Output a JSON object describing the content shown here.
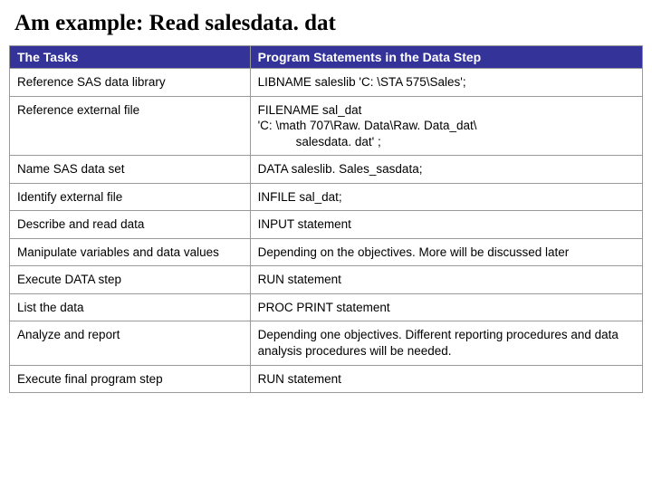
{
  "title": "Am example: Read salesdata. dat",
  "table": {
    "headers": {
      "tasks": "The Tasks",
      "statements": "Program Statements in the Data Step"
    },
    "rows": [
      {
        "task": "Reference SAS data library",
        "stmt": "LIBNAME saleslib 'C: \\STA 575\\Sales';"
      },
      {
        "task": "Reference external file",
        "stmt_line1": "FILENAME sal_dat",
        "stmt_line2": "'C: \\math 707\\Raw. Data\\Raw. Data_dat\\",
        "stmt_line3": "salesdata. dat' ;"
      },
      {
        "task": "Name SAS data set",
        "stmt": "DATA saleslib. Sales_sasdata;"
      },
      {
        "task": "Identify external file",
        "stmt": "INFILE sal_dat;"
      },
      {
        "task": "Describe and read data",
        "stmt": "INPUT statement"
      },
      {
        "task": "Manipulate variables and data values",
        "stmt": "Depending on the objectives. More will be discussed later"
      },
      {
        "task": "Execute DATA step",
        "stmt": "RUN statement"
      },
      {
        "task": "List the data",
        "stmt": "PROC PRINT statement"
      },
      {
        "task": "Analyze and report",
        "stmt": "Depending one objectives. Different reporting procedures and data analysis procedures will be needed."
      },
      {
        "task": "Execute final program step",
        "stmt": "RUN statement"
      }
    ]
  }
}
